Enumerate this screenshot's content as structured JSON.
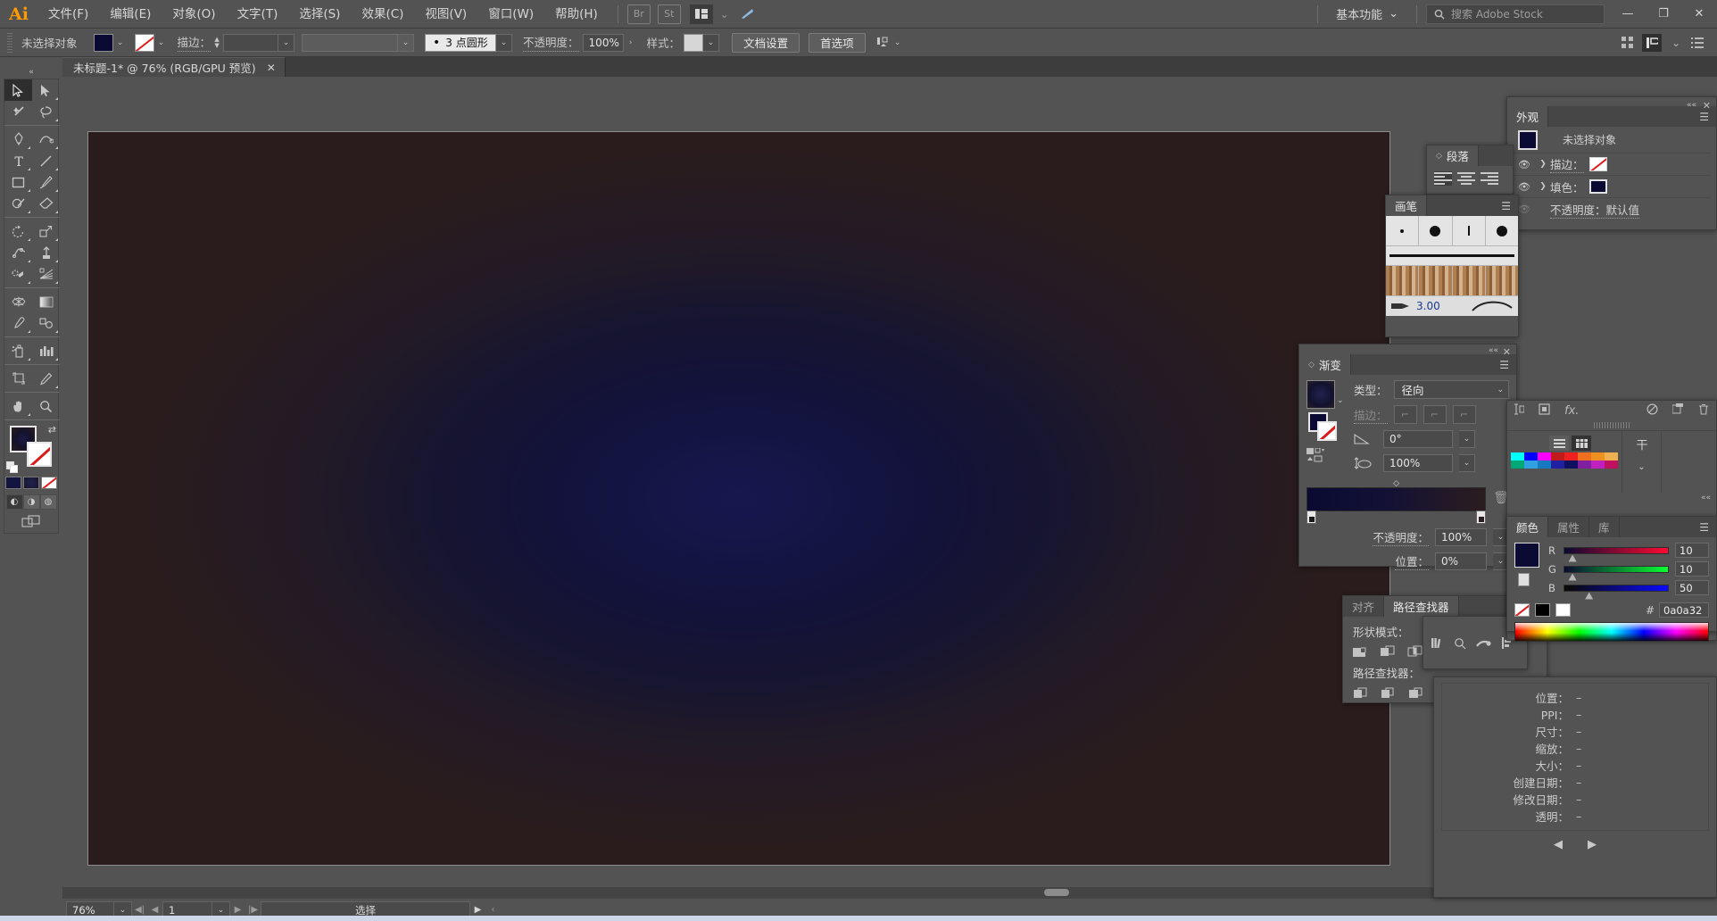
{
  "app": {
    "name": "Adobe Illustrator",
    "logo": "Ai"
  },
  "menubar": {
    "items": [
      "文件(F)",
      "编辑(E)",
      "对象(O)",
      "文字(T)",
      "选择(S)",
      "效果(C)",
      "视图(V)",
      "窗口(W)",
      "帮助(H)"
    ],
    "bridge_label": "Br",
    "stock_label": "St",
    "arrange_caret": "⌄",
    "workspace": "基本功能",
    "workspace_caret": "⌄",
    "search_placeholder": "搜索 Adobe Stock",
    "search_icon": "search-icon",
    "window_minimize": "—",
    "window_restore": "❐",
    "window_close": "✕"
  },
  "controlbar": {
    "selection_status": "未选择对象",
    "fill_color": "#0a0a32",
    "stroke_label": "描边：",
    "stroke_weight_value": "",
    "stroke_profile_value": "",
    "brush_def": "3 点圆形",
    "opacity_label": "不透明度：",
    "opacity_value": "100%",
    "style_label": "样式：",
    "doc_setup": "文档设置",
    "preferences": "首选项",
    "align_caret": "⌄"
  },
  "tab": {
    "title": "未标题-1* @ 76% (RGB/GPU 预览)",
    "close": "✕"
  },
  "toolbar": {
    "collapse": "«",
    "tools": [
      {
        "name": "selection-tool",
        "selected": true
      },
      {
        "name": "direct-selection-tool",
        "selected": false
      },
      {
        "name": "magic-wand-tool",
        "selected": false
      },
      {
        "name": "lasso-tool",
        "selected": false
      },
      {
        "name": "pen-tool",
        "selected": false
      },
      {
        "name": "curvature-tool",
        "selected": false
      },
      {
        "name": "type-tool",
        "selected": false
      },
      {
        "name": "line-segment-tool",
        "selected": false
      },
      {
        "name": "rectangle-tool",
        "selected": false
      },
      {
        "name": "paintbrush-tool",
        "selected": false
      },
      {
        "name": "shaper-tool",
        "selected": false
      },
      {
        "name": "eraser-tool",
        "selected": false
      },
      {
        "name": "rotate-tool",
        "selected": false
      },
      {
        "name": "scale-tool",
        "selected": false
      },
      {
        "name": "width-tool",
        "selected": false
      },
      {
        "name": "free-transform-tool",
        "selected": false
      },
      {
        "name": "shape-builder-tool",
        "selected": false
      },
      {
        "name": "perspective-grid-tool",
        "selected": false
      },
      {
        "name": "mesh-tool",
        "selected": false
      },
      {
        "name": "gradient-tool",
        "selected": false
      },
      {
        "name": "eyedropper-tool",
        "selected": false
      },
      {
        "name": "blend-tool",
        "selected": false
      },
      {
        "name": "symbol-sprayer-tool",
        "selected": false
      },
      {
        "name": "column-graph-tool",
        "selected": false
      },
      {
        "name": "artboard-tool",
        "selected": false
      },
      {
        "name": "slice-tool",
        "selected": false
      },
      {
        "name": "hand-tool",
        "selected": false
      },
      {
        "name": "zoom-tool",
        "selected": false
      }
    ],
    "fill_swatch": "#141233",
    "stroke_swatch": "none",
    "gradient_boxes": [
      "#17174a",
      "#1a1a3d",
      "none"
    ],
    "draw_modes": [
      "draw-normal",
      "draw-behind",
      "draw-inside"
    ],
    "screen_mode": "screen-mode-icon"
  },
  "canvas": {
    "artboard_bg_center": "#141440",
    "artboard_bg_edge": "#2a1c1d",
    "gradient_type": "radial"
  },
  "statusbar": {
    "zoom": "76%",
    "zoom_caret": "⌄",
    "page": "1",
    "page_caret": "⌄",
    "nav_first": "◀|",
    "nav_prev": "◀",
    "nav_next": "▶",
    "nav_last": "|▶",
    "status_text": "选择",
    "play": "▶",
    "more": "‹"
  },
  "panels": {
    "appearance": {
      "tab": "外观",
      "menu_icon": "panel-menu-icon",
      "target": "未选择对象",
      "rows": [
        {
          "eye": "visible",
          "label": "描边：",
          "swatch": "none"
        },
        {
          "eye": "visible",
          "label": "填色：",
          "swatch": "#0a0a32"
        },
        {
          "eye": "hidden",
          "label": "不透明度：默认值",
          "swatch": null
        }
      ]
    },
    "paragraph": {
      "tab": "段落",
      "align_options": [
        "align-left",
        "align-center",
        "align-right"
      ],
      "selected_align": 0
    },
    "brushes": {
      "tab": "画笔",
      "size_value": "3.00",
      "menu_icon": "panel-menu-icon"
    },
    "gradient": {
      "tab": "渐变",
      "menu_icon": "panel-menu-icon",
      "type_label": "类型：",
      "type_value": "径向",
      "stroke_label": "描边：",
      "angle_label": "angle-icon",
      "angle_value": "0°",
      "aspect_label": "aspect-ratio-icon",
      "aspect_value": "100%",
      "opacity_label": "不透明度：",
      "opacity_value": "100%",
      "location_label": "位置：",
      "location_value": "0%",
      "stop_left_color": "#0a0a32",
      "stop_right_color": "#2b1d1f",
      "delete_icon": "trash-icon"
    },
    "pathfinder": {
      "tabs": [
        "对齐",
        "路径查找器"
      ],
      "active_tab": 1,
      "shape_modes_label": "形状模式：",
      "pathfinder_label": "路径查找器：",
      "shape_mode_buttons": [
        "unite",
        "minus-front",
        "intersect",
        "exclude"
      ],
      "pathfinder_buttons": [
        "divide",
        "trim",
        "merge",
        "crop",
        "outline",
        "minus-back"
      ]
    },
    "transparency_strip": {
      "icons": [
        "libraries-icon",
        "symbols-icon",
        "brush-libraries-icon",
        "align-icon"
      ]
    },
    "layers_iconbar": {
      "icons": [
        "mask-icon",
        "fx-icon",
        "no-icon",
        "new-layer-icon",
        "trash-icon"
      ]
    },
    "swatches": {
      "view_list": "list-view-icon",
      "view_grid": "grid-view-icon",
      "row1": [
        "#00ffff",
        "#0000ff",
        "#ff00ff",
        "#c01a1a",
        "#ee2020",
        "#f07020",
        "#f09020",
        "#f0b050"
      ],
      "row2": [
        "#00a878",
        "#30a0e0",
        "#1878c0",
        "#2020a0",
        "#101060",
        "#8020a0",
        "#c020c0",
        "#c01060"
      ]
    },
    "color": {
      "tabs": [
        "颜色",
        "属性",
        "库"
      ],
      "active_tab": 0,
      "menu_icon": "panel-menu-icon",
      "chip": "#0a0a32",
      "channels": [
        {
          "label": "R",
          "value": "10",
          "pct": 4
        },
        {
          "label": "G",
          "value": "10",
          "pct": 4
        },
        {
          "label": "B",
          "value": "50",
          "pct": 20
        }
      ],
      "hex_symbol": "#",
      "hex_value": "0a0a32",
      "bottom_swatches": [
        "none",
        "#000000",
        "#ffffff"
      ]
    },
    "info": {
      "rows": [
        {
          "k": "位置：",
          "v": "–"
        },
        {
          "k": "PPI：",
          "v": "–"
        },
        {
          "k": "尺寸：",
          "v": "–"
        },
        {
          "k": "缩放：",
          "v": "–"
        },
        {
          "k": "大小：",
          "v": "–"
        },
        {
          "k": "创建日期：",
          "v": "–"
        },
        {
          "k": "修改日期：",
          "v": "–"
        },
        {
          "k": "透明：",
          "v": "–"
        }
      ],
      "nav_prev": "◀",
      "nav_next": "▶"
    }
  }
}
